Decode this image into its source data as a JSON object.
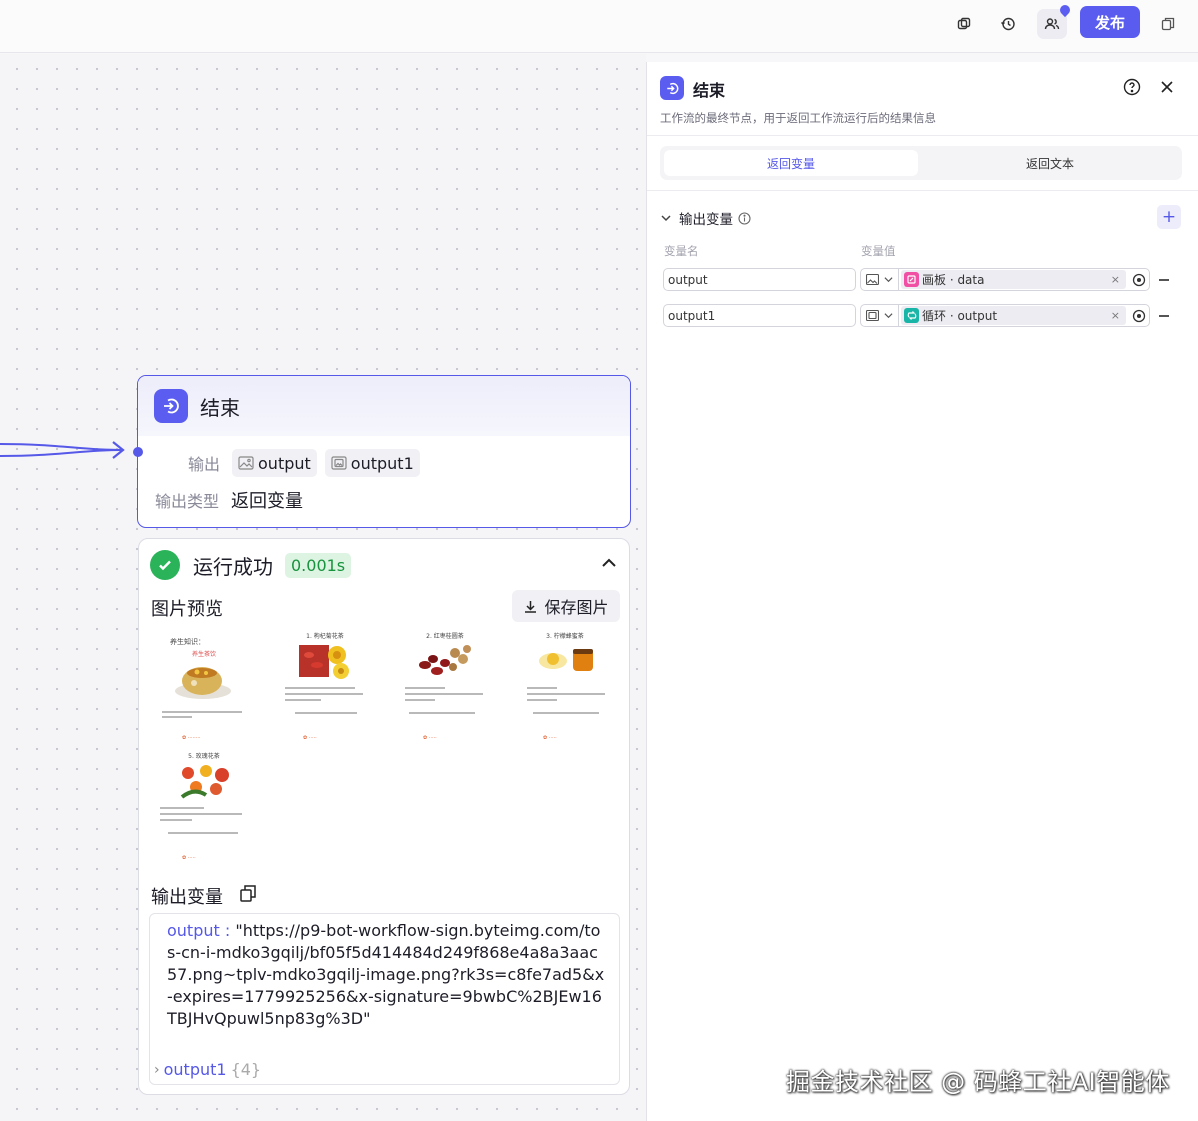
{
  "topbar": {
    "publish_label": "发布"
  },
  "node": {
    "title": "结束",
    "output_label": "输出",
    "outputs": [
      "output",
      "output1"
    ],
    "output_type_label": "输出类型",
    "output_type_value": "返回变量"
  },
  "result": {
    "status": "运行成功",
    "duration": "0.001s",
    "image_preview_title": "图片预览",
    "save_image_label": "保存图片",
    "thumbnails": [
      {
        "title": "养生知识：",
        "subtitle": "养生茶饮"
      },
      {
        "title": "1. 枸杞菊花茶"
      },
      {
        "title": "2. 红枣桂圆茶"
      },
      {
        "title": "3. 柠檬蜂蜜茶"
      },
      {
        "title": "5. 玫瑰花茶"
      }
    ],
    "output_vars_title": "输出变量",
    "output_key": "output",
    "output_value": "\"https://p9-bot-workflow-sign.byteimg.com/tos-cn-i-mdko3gqilj/bf05f5d414484d249f868e4a8a3aac57.png~tplv-mdko3gqilj-image.png?rk3s=c8fe7ad5&x-expires=1779925256&x-signature=9bwbC%2BJEw16TBJHvQpuwl5np83g%3D\"",
    "output1_key": "output1",
    "output1_count": "{4}"
  },
  "panel": {
    "title": "结束",
    "description": "工作流的最终节点，用于返回工作流运行后的结果信息",
    "tabs": [
      "返回变量",
      "返回文本"
    ],
    "section_title": "输出变量",
    "col_name": "变量名",
    "col_value": "变量值",
    "rows": [
      {
        "name": "output",
        "ref": "画板 · data",
        "ref_color": "#f04fa4"
      },
      {
        "name": "output1",
        "ref": "循环 · output",
        "ref_color": "#19b6a8"
      }
    ]
  },
  "watermark": "掘金技术社区 @ 码蜂工社AI智能体",
  "colors": {
    "accent": "#5a5cf0",
    "success": "#2bb35a"
  }
}
